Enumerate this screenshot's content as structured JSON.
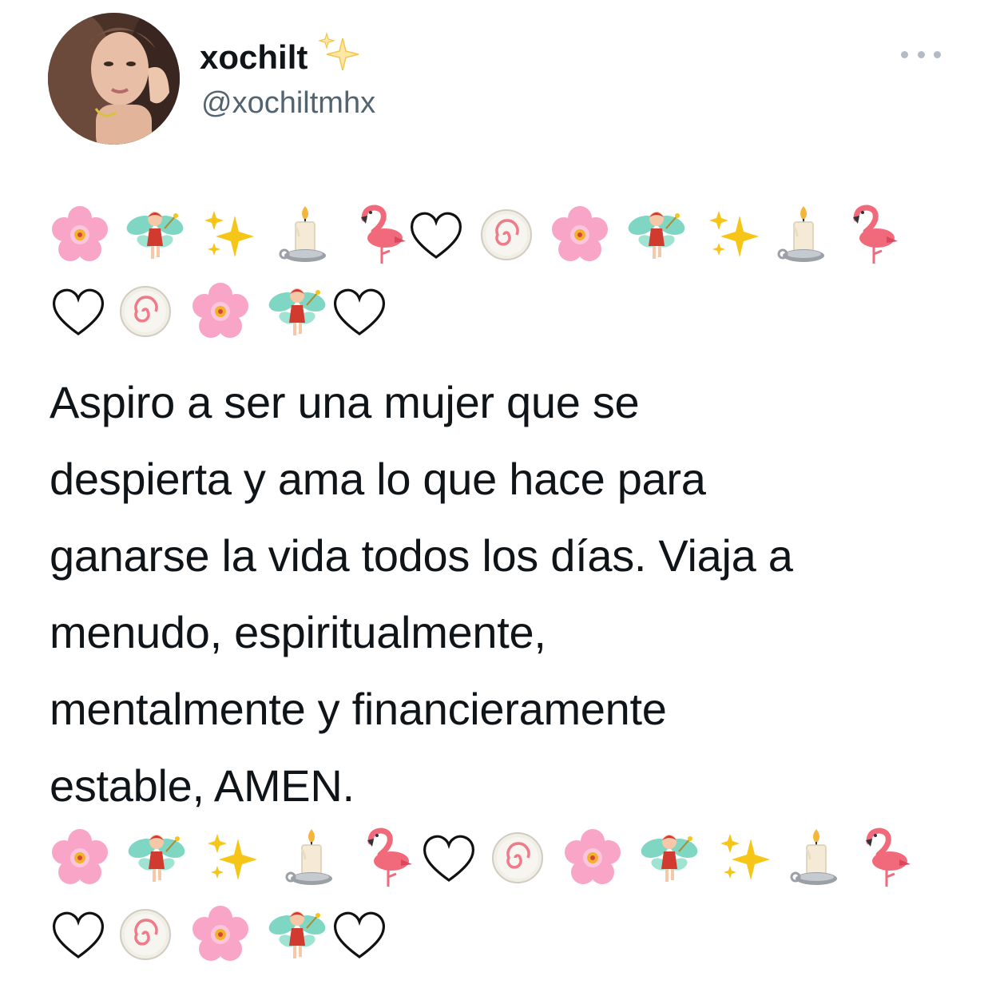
{
  "tweet": {
    "author": {
      "display_name": "xochilt",
      "name_emoji": "sparkles-icon",
      "handle": "@xochiltmhx"
    },
    "more_button": "more-icon",
    "lines": [
      "Aspiro a ser una mujer que se",
      "despierta y ama lo que hace para",
      "ganarse la vida todos los días. Viaja a",
      "menudo, espiritualmente,",
      "mentalmente y financieramente",
      "estable, AMEN."
    ],
    "emoji_block": {
      "row_1": [
        "cherry-blossom",
        "fairy",
        "sparkles",
        "candle",
        "flamingo",
        "white-heart",
        "fish-cake",
        "cherry-blossom",
        "fairy",
        "sparkles",
        "candle",
        "flamingo"
      ],
      "row_2": [
        "white-heart",
        "fish-cake",
        "cherry-blossom",
        "fairy",
        "white-heart"
      ]
    }
  },
  "colors": {
    "text": "#0f1419",
    "secondary_text": "#536471",
    "blossom": "#f8a5c8",
    "flamingo": "#f06a7b",
    "fairy_wing": "#7fd6c2",
    "sparkle": "#f5c518"
  }
}
